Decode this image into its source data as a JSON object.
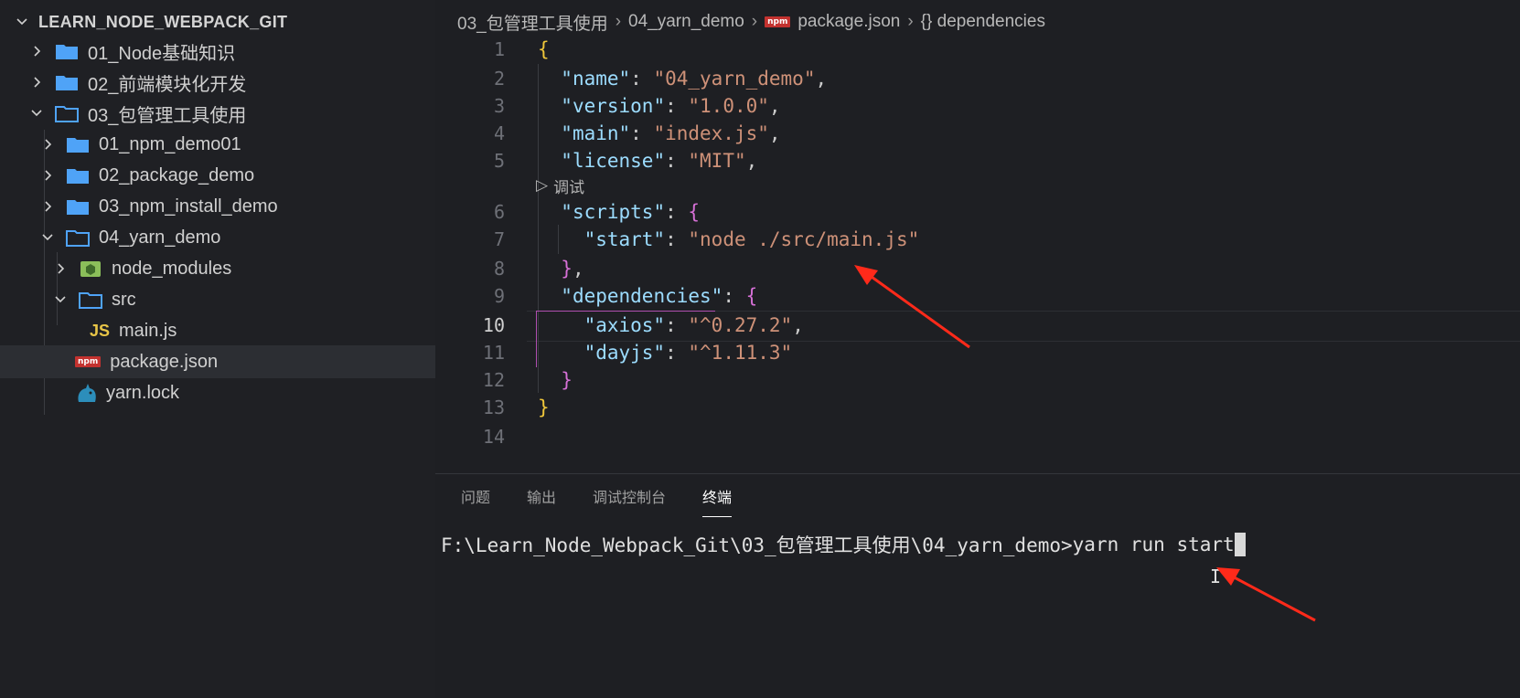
{
  "explorer": {
    "title": "LEARN_NODE_WEBPACK_GIT",
    "items": [
      {
        "label": "01_Node基础知识",
        "kind": "folder",
        "open": false
      },
      {
        "label": "02_前端模块化开发",
        "kind": "folder",
        "open": false
      },
      {
        "label": "03_包管理工具使用",
        "kind": "folder",
        "open": true
      },
      {
        "label": "01_npm_demo01",
        "kind": "folder",
        "open": false
      },
      {
        "label": "02_package_demo",
        "kind": "folder",
        "open": false
      },
      {
        "label": "03_npm_install_demo",
        "kind": "folder",
        "open": false
      },
      {
        "label": "04_yarn_demo",
        "kind": "folder",
        "open": true
      },
      {
        "label": "node_modules",
        "kind": "node-folder",
        "open": false
      },
      {
        "label": "src",
        "kind": "folder",
        "open": true
      },
      {
        "label": "main.js",
        "kind": "js-file",
        "icon_text": "JS"
      },
      {
        "label": "package.json",
        "kind": "npm-file",
        "icon_text": "npm"
      },
      {
        "label": "yarn.lock",
        "kind": "yarn-file"
      }
    ]
  },
  "breadcrumb": {
    "part1": "03_包管理工具使用",
    "part2": "04_yarn_demo",
    "file_badge": "npm",
    "part3": "package.json",
    "part4": "{} dependencies"
  },
  "editor": {
    "debug_hint": "调试",
    "active_line": 10,
    "line_numbers": [
      "1",
      "2",
      "3",
      "4",
      "5",
      "6",
      "7",
      "8",
      "9",
      "10",
      "11",
      "12",
      "13",
      "14"
    ],
    "lines": {
      "l1": "{",
      "l2_key": "\"name\"",
      "l2_val": "\"04_yarn_demo\"",
      "l3_key": "\"version\"",
      "l3_val": "\"1.0.0\"",
      "l4_key": "\"main\"",
      "l4_val": "\"index.js\"",
      "l5_key": "\"license\"",
      "l5_val": "\"MIT\"",
      "l6_key": "\"scripts\"",
      "l6_brace": "{",
      "l7_key": "\"start\"",
      "l7_val": "\"node ./src/main.js\"",
      "l8_brace": "}",
      "l9_key": "\"dependencies\"",
      "l9_brace": "{",
      "l10_key": "\"axios\"",
      "l10_val": "\"^0.27.2\"",
      "l11_key": "\"dayjs\"",
      "l11_val": "\"^1.11.3\"",
      "l12_brace": "}",
      "l13": "}"
    }
  },
  "panel": {
    "tabs": [
      "问题",
      "输出",
      "调试控制台",
      "终端"
    ],
    "active_tab": "终端",
    "prompt_path": "F:\\Learn_Node_Webpack_Git\\03_包管理工具使用\\04_yarn_demo>",
    "command": "yarn run start"
  },
  "colors": {
    "annotation_arrow": "#ff2a1a",
    "folder_blue": "#4fa3f7",
    "string": "#ce9178",
    "key": "#9cdcfe"
  }
}
